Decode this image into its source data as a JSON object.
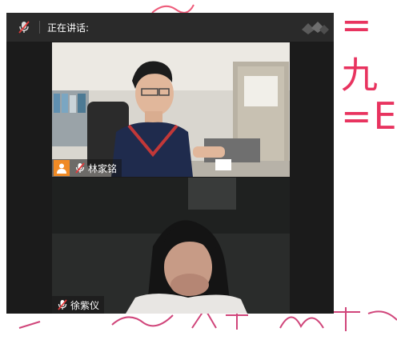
{
  "meeting": {
    "speaking_label": "正在讲话:",
    "participants": [
      {
        "name": "林家铭",
        "mic_icon": "mic-muted-icon",
        "has_avatar_badge": true
      },
      {
        "name": "徐紫仪",
        "mic_icon": "mic-muted-icon",
        "has_avatar_badge": false
      }
    ]
  },
  "background": {
    "eq1": "=九",
    "eq2": "=E"
  },
  "colors": {
    "window_bg": "#1b1b1b",
    "titlebar_bg": "#2a2a2a",
    "avatar_badge": "#f08a24",
    "mic_muted": "#e23a3a",
    "whiteboard_ink": "#e8335f"
  }
}
